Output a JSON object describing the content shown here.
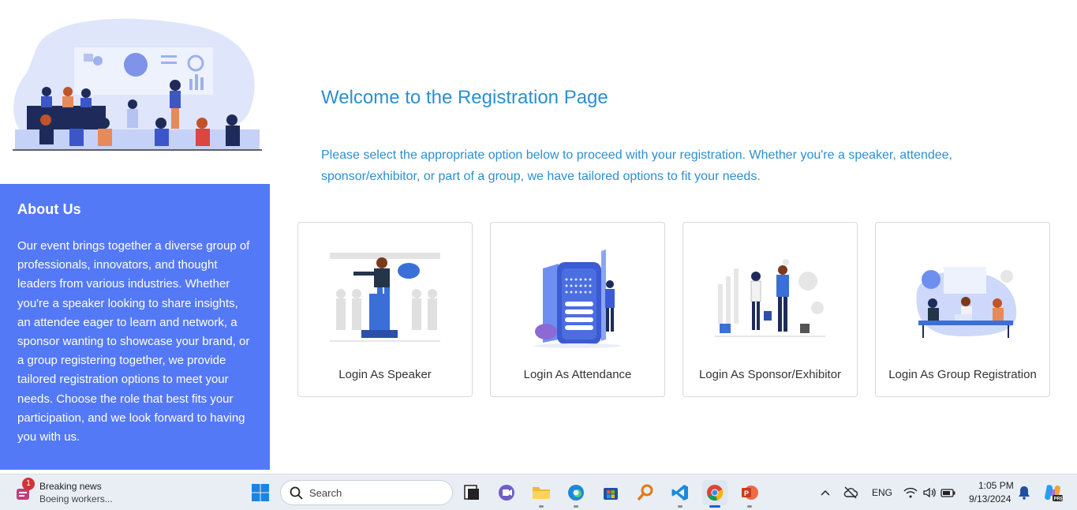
{
  "main": {
    "welcome_title": "Welcome to the Registration Page",
    "intro_text": "Please select the appropriate option below to proceed with your registration. Whether you're a speaker, attendee, sponsor/exhibitor, or part of a group, we have tailored options to fit your needs.",
    "cards": [
      {
        "label": "Login As Speaker",
        "icon": "speaker-illustration"
      },
      {
        "label": "Login As Attendance",
        "icon": "attendee-phone-illustration"
      },
      {
        "label": "Login As Sponsor/Exhibitor",
        "icon": "sponsor-handshake-illustration"
      },
      {
        "label": "Login As Group Registration",
        "icon": "group-meeting-illustration"
      }
    ]
  },
  "about": {
    "heading": "About Us",
    "body": "Our event brings together a diverse group of professionals, innovators, and thought leaders from various industries. Whether you're a speaker looking to share insights, an attendee eager to learn and network, a sponsor wanting to showcase your brand, or a group registering together, we provide tailored registration options to meet your needs. Choose the role that best fits your participation, and we look forward to having you with us."
  },
  "colors": {
    "accent_text": "#2c8fcf",
    "about_bg": "#5479f7"
  },
  "taskbar": {
    "news_badge": "1",
    "news_title": "Breaking news",
    "news_sub": "Boeing workers...",
    "search_placeholder": "Search",
    "language": "ENG",
    "time": "1:05 PM",
    "date": "9/13/2024",
    "apps": [
      "start-icon",
      "task-view-icon",
      "teams-icon",
      "file-explorer-icon",
      "edge-icon",
      "store-icon",
      "search-app-icon",
      "vscode-icon",
      "chrome-icon",
      "powerpoint-icon"
    ]
  }
}
